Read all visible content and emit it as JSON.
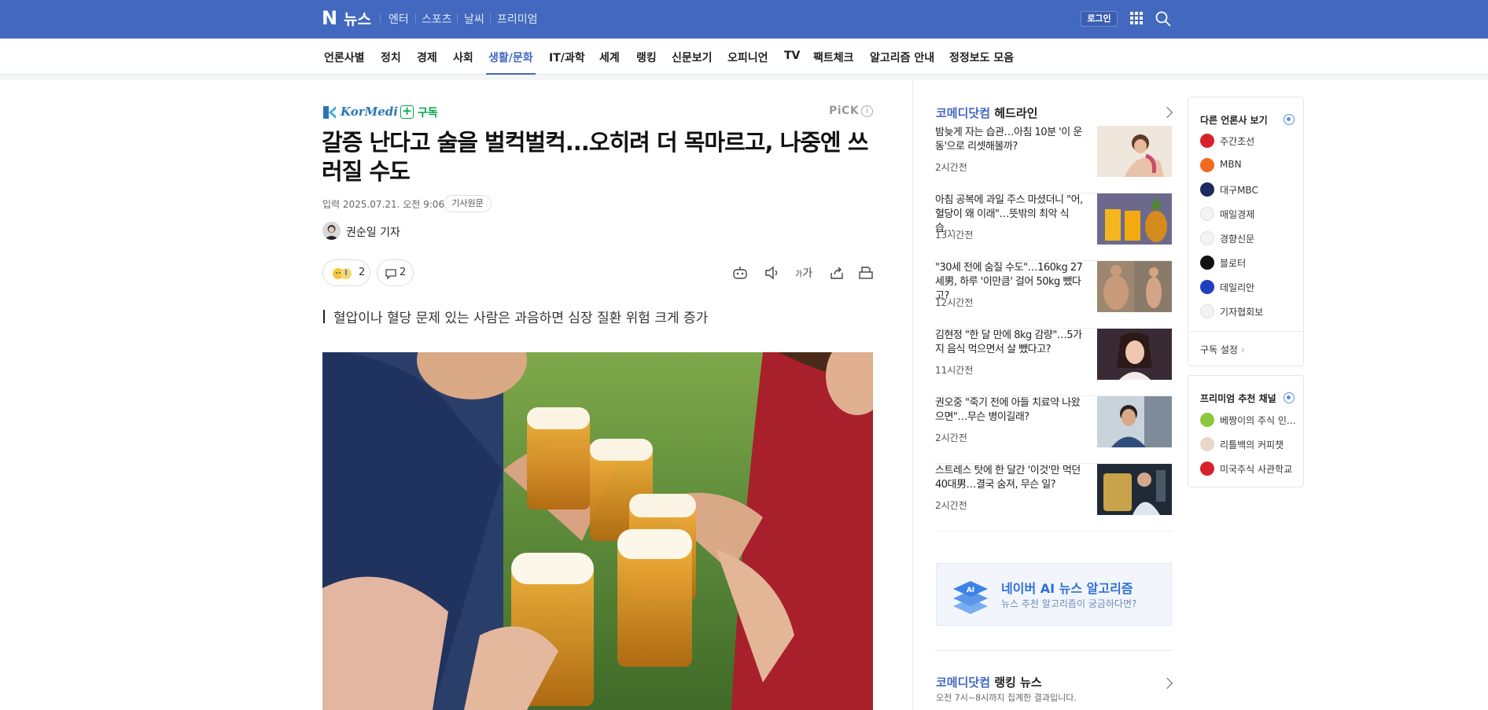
{
  "top": {
    "logo_mark": "N",
    "logo_text": "뉴스",
    "services": [
      "엔터",
      "스포츠",
      "날씨",
      "프리미엄"
    ],
    "login": "로그인",
    "grid_icon": "apps-grid-icon",
    "search_icon": "search-icon"
  },
  "nav": {
    "items": [
      "언론사별",
      "정치",
      "경제",
      "사회",
      "생활/문화",
      "IT/과학",
      "세계",
      "랭킹",
      "신문보기",
      "오피니언",
      "TV",
      "팩트체크",
      "알고리즘 안내",
      "정정보도 모음"
    ],
    "active": "생활/문화"
  },
  "article": {
    "press_name": "KorMedi",
    "subscribe": "구독",
    "pick": "PiCK",
    "pick_info": "i",
    "headline": "갈증 난다고 술을 벌컥벌컥...오히려 더 목마르고, 나중엔 쓰러질 수도",
    "date": "입력 2025.07.21. 오전 9:06",
    "original_button": "기사원문",
    "reporter": "권순일 기자",
    "reaction_count": "2",
    "comment_count": "2",
    "font_size_label": "가",
    "summary": "혈압이나 혈당 문제 있는 사람은 과음하면 심장 질환 위험 크게 증가"
  },
  "headlines": {
    "press": "코메디닷컴",
    "title": "헤드라인",
    "items": [
      {
        "title": "밤늦게 자는 습관…아침 10분 '이 운동'으로 리셋해볼까?",
        "time": "2시간전"
      },
      {
        "title": "아침 공복에 과일 주스 마셨더니 \"어, 혈당이 왜 이래\"…뜻밖의 최악 식습…",
        "time": "13시간전"
      },
      {
        "title": "\"30세 전에 숨질 수도\"…160kg 27세男, 하루 '이만큼' 걸어 50kg 뺐다고?",
        "time": "12시간전"
      },
      {
        "title": "김현정 \"한 달 만에 8kg 감량\"…5가지 음식 먹으면서 살 뺐다고?",
        "time": "11시간전"
      },
      {
        "title": "권오중 \"죽기 전에 아들 치료약 나왔으면\"…무슨 병이길래?",
        "time": "2시간전"
      },
      {
        "title": "스트레스 탓에 한 달간 '이것'만 먹던 40대男…결국 숨져, 무슨 일?",
        "time": "2시간전"
      }
    ]
  },
  "ai": {
    "title": "네이버 AI 뉴스 알고리즘",
    "subtitle": "뉴스 추천 알고리즘이 궁금하다면?",
    "badge": "AI"
  },
  "ranking": {
    "press": "코메디닷컴",
    "title": "랭킹 뉴스",
    "subtitle": "오전 7시~8시까지 집계한 결과입니다."
  },
  "other_press": {
    "title": "다른 언론사 보기",
    "items": [
      {
        "name": "주간조선",
        "color": "#d6222b"
      },
      {
        "name": "MBN",
        "color": "#f26a21"
      },
      {
        "name": "대구MBC",
        "color": "#1c2a5c"
      },
      {
        "name": "매일경제",
        "color": "#f3f3f3"
      },
      {
        "name": "경향신문",
        "color": "#f3f3f3"
      },
      {
        "name": "블로터",
        "color": "#111111"
      },
      {
        "name": "데일리안",
        "color": "#1f3fbf"
      },
      {
        "name": "기자협회보",
        "color": "#f3f3f3"
      }
    ],
    "setting": "구독 설정"
  },
  "premium": {
    "title": "프리미엄 추천 채널",
    "items": [
      {
        "name": "베짱이의 주식 인…",
        "color": "#8dc63f"
      },
      {
        "name": "리틀백의 커피챗",
        "color": "#e9d7c7"
      },
      {
        "name": "미국주식 사관학교",
        "color": "#d6222b"
      }
    ]
  },
  "colors": {
    "brand": "#4269bf",
    "subscribe": "#03a94f",
    "ai": "#2e6fd9"
  }
}
